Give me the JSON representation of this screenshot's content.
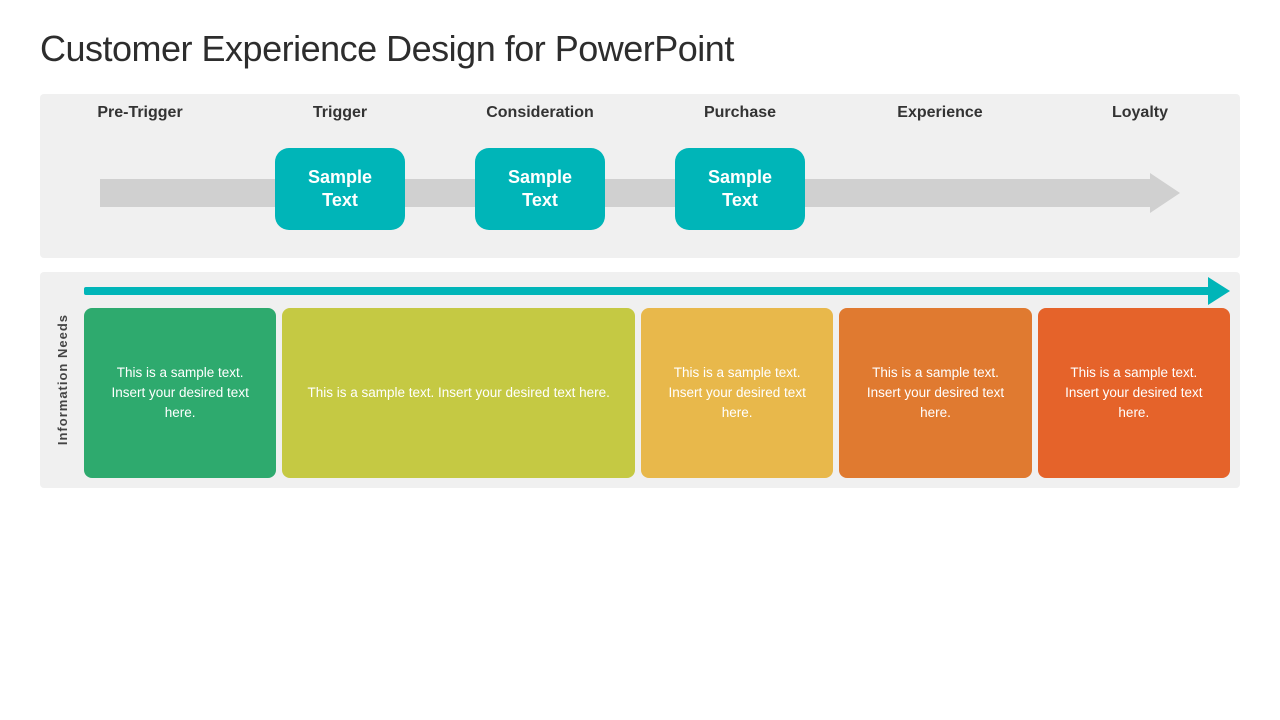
{
  "title": "Customer Experience Design for PowerPoint",
  "stages": {
    "headers": [
      "Pre-Trigger",
      "Trigger",
      "Consideration",
      "Purchase",
      "Experience",
      "Loyalty"
    ],
    "boxes": [
      {
        "id": "trigger",
        "text": "Sample\nText",
        "visible": true
      },
      {
        "id": "consideration",
        "text": "Sample\nText",
        "visible": true
      },
      {
        "id": "purchase",
        "text": "Sample\nText",
        "visible": true
      }
    ]
  },
  "info_section": {
    "label": "Information Needs",
    "arrow_bar": "timeline arrow",
    "cards": [
      {
        "id": "card1",
        "color_class": "card-green",
        "text": "This is a sample text.  Insert your desired text here."
      },
      {
        "id": "card2",
        "color_class": "card-yellow",
        "text": "This is a sample text.  Insert your desired text here."
      },
      {
        "id": "card3",
        "color_class": "card-gold",
        "text": "This is a sample text.  Insert your desired text here."
      },
      {
        "id": "card4",
        "color_class": "card-orange",
        "text": "This is a sample text.  Insert your desired text here."
      },
      {
        "id": "card5",
        "color_class": "card-red-orange",
        "text": "This is a sample text.  Insert your desired text here."
      }
    ]
  },
  "stage_box_text": {
    "sample": "Sample Text"
  }
}
